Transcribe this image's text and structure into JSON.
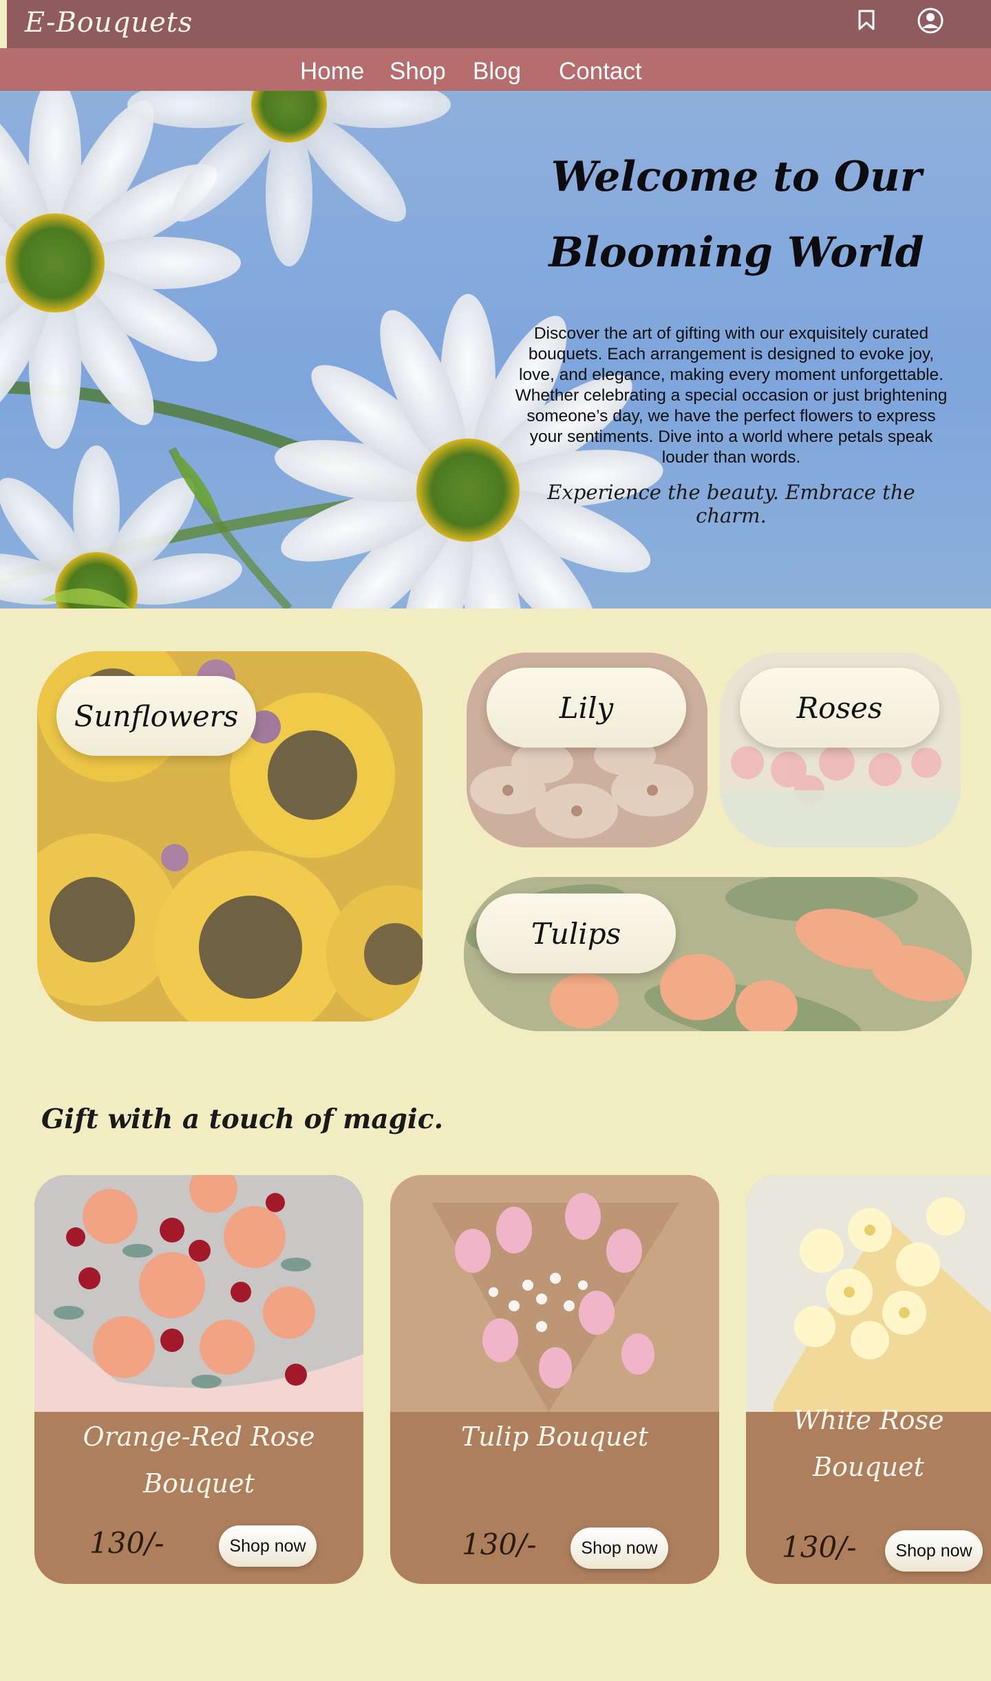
{
  "header": {
    "logo": "E-Bouquets",
    "icons": [
      "bookmark-icon",
      "user-circle-icon"
    ],
    "nav": [
      {
        "label": "Home"
      },
      {
        "label": "Shop"
      },
      {
        "label": "Blog"
      },
      {
        "label": "Contact"
      }
    ]
  },
  "hero": {
    "title_line1": "Welcome to Our",
    "title_line2": "Blooming World",
    "description": "Discover the art of gifting with our exquisitely curated bouquets. Each arrangement is designed to evoke joy, love, and elegance, making every moment unforgettable. Whether celebrating a special occasion or just brightening someone’s day, we have the perfect flowers to express your sentiments. Dive into a world where petals speak louder than words.",
    "tagline": "Experience the beauty. Embrace the charm."
  },
  "categories": [
    {
      "label": "Sunflowers"
    },
    {
      "label": "Lily"
    },
    {
      "label": "Roses"
    },
    {
      "label": "Tulips"
    }
  ],
  "products_section": {
    "title": "Gift with a touch of magic.",
    "items": [
      {
        "name_line1": "Orange-Red Rose",
        "name_line2": "Bouquet",
        "price": "130/-",
        "button": "Shop now"
      },
      {
        "name_line1": "Tulip Bouquet",
        "name_line2": "",
        "price": "130/-",
        "button": "Shop now"
      },
      {
        "name_line1": "White Rose",
        "name_line2": "Bouquet",
        "price": "130/-",
        "button": "Shop now"
      }
    ]
  },
  "colors": {
    "page_bg": "#f2ecc3",
    "topbar": "#905b5e",
    "navbar": "#b56d6d",
    "card": "#ad7f5c"
  }
}
